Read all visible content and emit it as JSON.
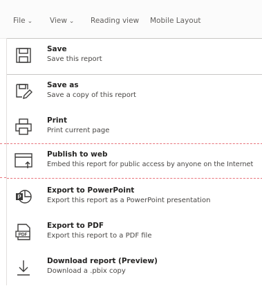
{
  "toolbar": {
    "file_label": "File",
    "view_label": "View",
    "reading_view_label": "Reading view",
    "mobile_layout_label": "Mobile Layout"
  },
  "menu": {
    "items": [
      {
        "title": "Save",
        "description": "Save this report",
        "icon": "save-icon"
      },
      {
        "title": "Save as",
        "description": "Save a copy of this report",
        "icon": "save-as-icon"
      },
      {
        "title": "Print",
        "description": "Print current page",
        "icon": "print-icon"
      },
      {
        "title": "Publish to web",
        "description": "Embed this report for public access by anyone on the Internet",
        "icon": "publish-to-web-icon"
      },
      {
        "title": "Export to PowerPoint",
        "description": "Export this report as a PowerPoint presentation",
        "icon": "powerpoint-icon"
      },
      {
        "title": "Export to PDF",
        "description": "Export this report to a PDF file",
        "icon": "pdf-icon"
      },
      {
        "title": "Download report (Preview)",
        "description": "Download a .pbix copy",
        "icon": "download-icon"
      }
    ]
  },
  "colors": {
    "highlight_dash": "#e8727a",
    "text_primary": "#252423",
    "text_secondary": "#484644"
  }
}
